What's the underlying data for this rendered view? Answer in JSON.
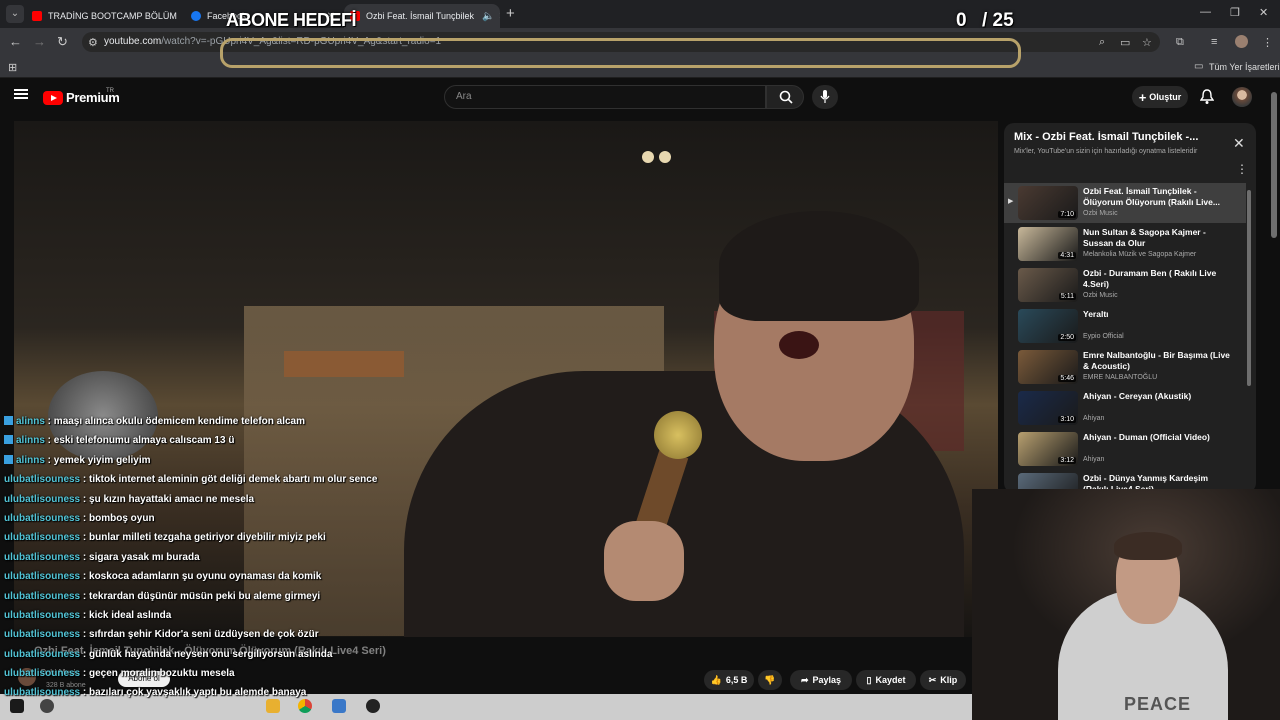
{
  "browser": {
    "tabs": [
      {
        "label": "TRADİNG BOOTCAMP BÖLÜM",
        "icon": "youtube-icon",
        "color": "#ff0000"
      },
      {
        "label": "Facebook",
        "icon": "facebook-icon",
        "color": "#1877f2"
      },
      {
        "label": "Ozbi Feat. İsmail Tunçbilek",
        "icon": "youtube-icon",
        "color": "#ff0000",
        "active": true
      }
    ],
    "url_host": "youtube.com",
    "url_rest": "/watch?v=-pGUpri4V_Ag&list=RD-pGUpri4V_Ag&start_radio=1",
    "bookmarks_label": "Tüm Yer İşaretleri"
  },
  "overlay": {
    "goal_label": "ABONE HEDEFİ",
    "goal_current": "0",
    "goal_target": "/ 25",
    "goal_progress": 0.0
  },
  "youtube": {
    "brand": "Premium",
    "brand_sup": "TR",
    "search_placeholder": "Ara",
    "create_label": "Oluştur"
  },
  "chat": [
    {
      "user": "alinns",
      "badge": true,
      "msg": "maaşı alınca okulu ödemicem kendime telefon alcam"
    },
    {
      "user": "alinns",
      "badge": true,
      "msg": "eski telefonumu almaya calıscam 13 ü"
    },
    {
      "user": "alinns",
      "badge": true,
      "msg": "yemek yiyim geliyim"
    },
    {
      "user": "ulubatlisouness",
      "badge": false,
      "msg": "tiktok internet aleminin göt deliği demek abartı mı olur sence"
    },
    {
      "user": "ulubatlisouness",
      "badge": false,
      "msg": "şu kızın hayattaki amacı ne mesela"
    },
    {
      "user": "ulubatlisouness",
      "badge": false,
      "msg": "bomboş oyun"
    },
    {
      "user": "ulubatlisouness",
      "badge": false,
      "msg": "bunlar milleti tezgaha getiriyor diyebilir miyiz peki"
    },
    {
      "user": "ulubatlisouness",
      "badge": false,
      "msg": "sigara yasak mı burada"
    },
    {
      "user": "ulubatlisouness",
      "badge": false,
      "msg": "koskoca adamların şu oyunu oynaması da komik"
    },
    {
      "user": "ulubatlisouness",
      "badge": false,
      "msg": "tekrardan düşünür müsün peki bu aleme girmeyi"
    },
    {
      "user": "ulubatlisouness",
      "badge": false,
      "msg": "kick ideal aslında"
    },
    {
      "user": "ulubatlisouness",
      "badge": false,
      "msg": "sıfırdan şehir Kidor'a seni üzdüysen de çok özür"
    },
    {
      "user": "ulubatlisouness",
      "badge": false,
      "msg": "günlük hayatında neysen onu sergiliyorsun aslında"
    },
    {
      "user": "ulubatlisouness",
      "badge": false,
      "msg": "geçen moralin bozuktu mesela"
    },
    {
      "user": "ulubatlisouness",
      "badge": false,
      "msg": "bazıları çok yavşaklık yaptı bu alemde banaya"
    }
  ],
  "video": {
    "title": "Ozbi Feat. İsmail Tunçbilek - Ölüyorum Ölüyorum (Rakılı Live4 Seri)",
    "channel": "Ozbi Music",
    "subscribers": "328 B abone",
    "subscribe_label": "Abone ol",
    "likes": "6,5 B",
    "share_label": "Paylaş",
    "save_label": "Kaydet",
    "clip_label": "Klip"
  },
  "playlist": {
    "title": "Mix - Ozbi Feat. İsmail Tunçbilek -...",
    "subtitle": "Mix'ler, YouTube'un sizin için hazırladığı oynatma listeleridir",
    "items": [
      {
        "title": "Ozbi Feat. İsmail Tunçbilek - Ölüyorum Ölüyorum (Rakılı Live...",
        "channel": "Ozbi Music",
        "duration": "7:10",
        "current": true,
        "color": "#4a3a32"
      },
      {
        "title": "Nun Sultan & Sagopa Kajmer - Sussan da Olur",
        "channel": "Melankolia Müzik ve Sagopa Kajmer",
        "duration": "4:31",
        "current": false,
        "color": "#c8b89a"
      },
      {
        "title": "Ozbi - Duramam Ben ( Rakılı Live 4.Seri)",
        "channel": "Ozbi Music",
        "duration": "5:11",
        "current": false,
        "color": "#6a5a4a"
      },
      {
        "title": "Yeraltı",
        "channel": "Eypio Official",
        "duration": "2:50",
        "current": false,
        "color": "#2a4a5a"
      },
      {
        "title": "Emre Nalbantoğlu - Bir Başıma (Live & Acoustic)",
        "channel": "EMRE NALBANTOĞLU",
        "duration": "5:46",
        "current": false,
        "color": "#7a5a3a"
      },
      {
        "title": "Ahiyan - Cereyan (Akustik)",
        "channel": "Ahiyan",
        "duration": "3:10",
        "current": false,
        "color": "#1a2a4a"
      },
      {
        "title": "Ahiyan - Duman (Official Video)",
        "channel": "Ahiyan",
        "duration": "3:12",
        "current": false,
        "color": "#b8a070"
      },
      {
        "title": "Ozbi - Dünya Yanmış Kardeşim (Rakılı Live4 Seri)",
        "channel": "",
        "duration": "",
        "current": false,
        "color": "#5a6a7a"
      }
    ]
  },
  "webcam": {
    "shirt_text": "PEACE"
  }
}
